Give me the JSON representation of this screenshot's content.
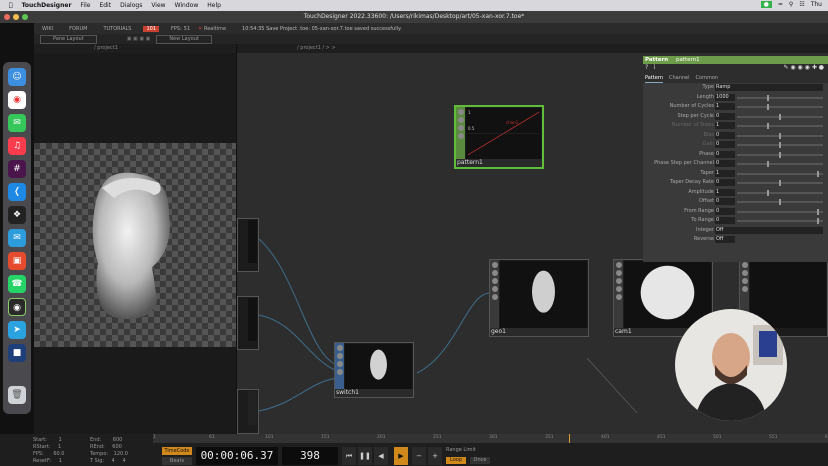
{
  "menubar": {
    "app": "TouchDesigner",
    "items": [
      "File",
      "Edit",
      "Dialogs",
      "View",
      "Window",
      "Help"
    ],
    "clock": "Thu"
  },
  "window_title": "TouchDesigner 2022.33600: /Users/rikimas/Desktop/art/05-xan-xor.7.toe*",
  "tdmenu": {
    "items": [
      "WIKI",
      "FORUM",
      "TUTORIALS"
    ],
    "badge": "101",
    "fps_label": "FPS:",
    "fps_value": "51",
    "realtime": "Realtime",
    "message": "10:54:35 Save Project .toe: 05-xan-xor.7.toe saved successfully."
  },
  "layoutrow": {
    "pane_layout": "Pane Layout",
    "new_layout": "New Layout"
  },
  "paths": {
    "left": "/ project1",
    "right": "/ project1 / > >"
  },
  "nodes": {
    "pattern": "pattern1",
    "geo": "geo1",
    "cam": "cam1",
    "switch": "switch1"
  },
  "pattern_preview": {
    "top": "1",
    "mid": "0.5",
    "series": "chan1"
  },
  "params": {
    "header_type": "Pattern",
    "header_name": "pattern1",
    "tabs": [
      "Pattern",
      "Channel",
      "Common"
    ],
    "rows": [
      {
        "label": "Type",
        "value": "Ramp"
      },
      {
        "label": "Length",
        "value": "1000"
      },
      {
        "label": "Number of Cycles",
        "value": "1"
      },
      {
        "label": "Step per Cycle",
        "value": "0"
      },
      {
        "label": "Number of Steps",
        "value": "1"
      },
      {
        "label": "Bias",
        "value": "0"
      },
      {
        "label": "Gain",
        "value": "0"
      },
      {
        "label": "Phase",
        "value": "0"
      },
      {
        "label": "Phase Step per Channel",
        "value": "0"
      },
      {
        "label": "Taper",
        "value": "1"
      },
      {
        "label": "Taper Decay Rate",
        "value": "0"
      },
      {
        "label": "Amplitude",
        "value": "1"
      },
      {
        "label": "Offset",
        "value": "0"
      },
      {
        "label": "From Range",
        "value": "0"
      },
      {
        "label": "To Range",
        "value": "0"
      },
      {
        "label": "Integer",
        "value": "Off"
      },
      {
        "label": "Reverse",
        "value": "Off"
      }
    ]
  },
  "timeline": {
    "ticks": [
      "1",
      "61",
      "101",
      "151",
      "201",
      "251",
      "301",
      "351",
      "401",
      "451",
      "501",
      "551",
      "600"
    ],
    "start_label": "Start:",
    "start": "1",
    "end_label": "End:",
    "end": "600",
    "rstart_label": "RStart:",
    "rstart": "1",
    "rend_label": "REnd:",
    "rend": "600",
    "fps_label": "FPS:",
    "fps": "60.0",
    "tempo_label": "Tempo:",
    "tempo": "120.0",
    "reset_label": "ResetF:",
    "reset": "1",
    "tsig_label": "T Sig:",
    "tsig": "4",
    "tsig2": "4",
    "timecode_label": "TimeCode",
    "beats_label": "Beats",
    "timecode": "00:00:06.37",
    "frame": "398",
    "range_limit": "Range Limit",
    "loop": "Loop",
    "once": "Once"
  }
}
